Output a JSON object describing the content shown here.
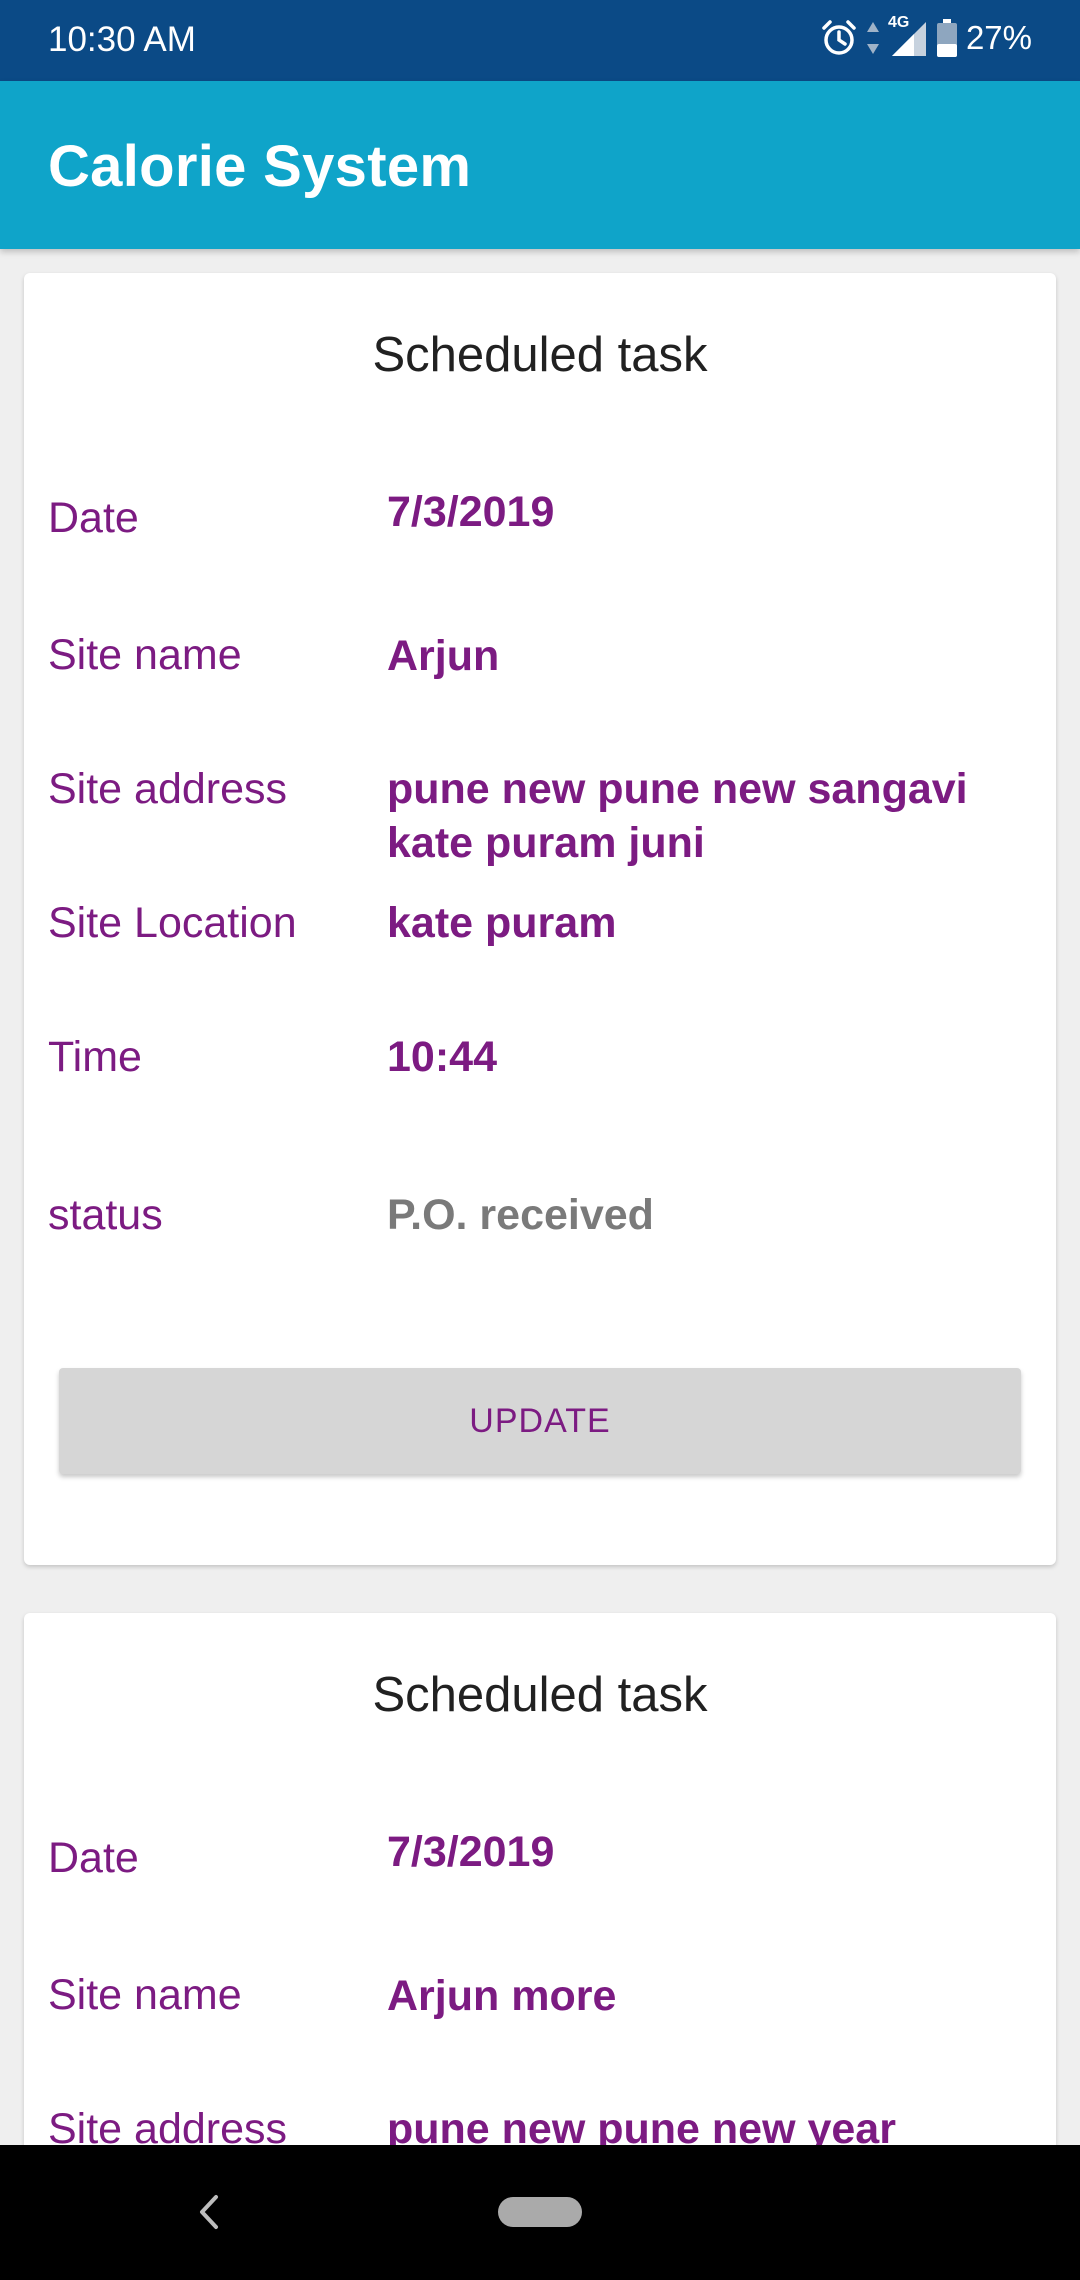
{
  "status_bar": {
    "time": "10:30 AM",
    "network": "4G",
    "battery": "27%",
    "icons": [
      "alarm-icon",
      "data-arrows-icon",
      "signal-icon",
      "battery-icon"
    ]
  },
  "app_bar": {
    "title": "Calorie System"
  },
  "cards": [
    {
      "title": "Scheduled task",
      "rows": [
        {
          "label": "Date",
          "value": "7/3/2019"
        },
        {
          "label": "Site name",
          "value": "Arjun"
        },
        {
          "label": "Site address",
          "value": "pune new pune new sangavi kate puram juni"
        },
        {
          "label": "Site Location",
          "value": "kate puram"
        },
        {
          "label": "Time",
          "value": "10:44"
        },
        {
          "label": "status",
          "value": "P.O. received"
        }
      ],
      "button": "UPDATE"
    },
    {
      "title": "Scheduled task",
      "rows": [
        {
          "label": "Date",
          "value": "7/3/2019"
        },
        {
          "label": "Site name",
          "value": "Arjun more"
        },
        {
          "label": "Site address",
          "value": "pune new pune new year"
        }
      ]
    }
  ],
  "nav_bar": {
    "icons": [
      "back-icon",
      "home-pill-icon"
    ]
  },
  "colors": {
    "status_bar": "#0b4a86",
    "app_bar": "#0fa4c9",
    "accent_text": "#7c1b82",
    "status_value": "#7a7a7a",
    "button_bg": "#d6d6d6"
  }
}
